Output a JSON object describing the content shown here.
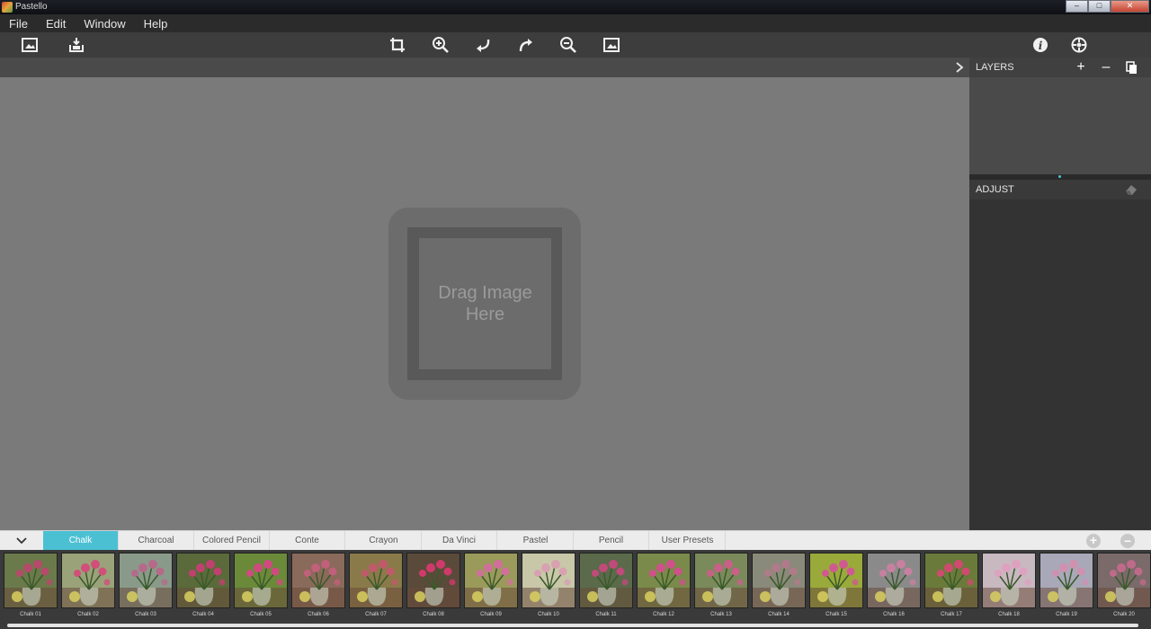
{
  "window": {
    "title": "Pastello"
  },
  "menu": [
    "File",
    "Edit",
    "Window",
    "Help"
  ],
  "toolbar": {
    "left": [
      "open-image-icon",
      "export-icon"
    ],
    "center": [
      "crop-icon",
      "zoom-in-icon",
      "undo-icon",
      "redo-icon",
      "zoom-out-icon",
      "fit-to-screen-icon"
    ],
    "right": [
      "info-icon",
      "settings-icon"
    ]
  },
  "canvas": {
    "drop_text": "Drag Image Here"
  },
  "panels": {
    "layers": {
      "title": "LAYERS"
    },
    "adjust": {
      "title": "ADJUST"
    }
  },
  "tabs": [
    "Chalk",
    "Charcoal",
    "Colored Pencil",
    "Conte",
    "Crayon",
    "Da Vinci",
    "Pastel",
    "Pencil",
    "User Presets"
  ],
  "active_tab": "Chalk",
  "presets": [
    "Chalk 01",
    "Chalk 02",
    "Chalk 03",
    "Chalk 04",
    "Chalk 05",
    "Chalk 06",
    "Chalk 07",
    "Chalk 08",
    "Chalk 09",
    "Chalk 10",
    "Chalk 11",
    "Chalk 12",
    "Chalk 13",
    "Chalk 14",
    "Chalk 15",
    "Chalk 16",
    "Chalk 17",
    "Chalk 18",
    "Chalk 19",
    "Chalk 20"
  ],
  "colors": {
    "accent": "#4bc0d3",
    "canvas": "#7a7a7a",
    "panel": "#333333",
    "toolbar": "#3d3d3d"
  }
}
